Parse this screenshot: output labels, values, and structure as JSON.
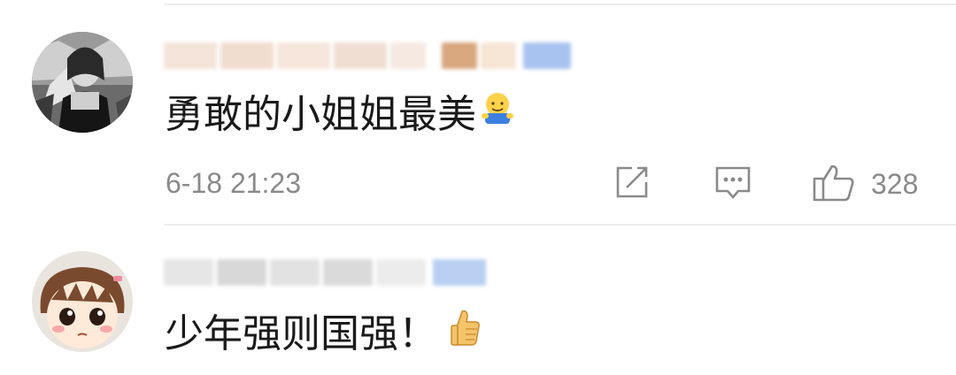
{
  "comments": [
    {
      "username": "",
      "text": "勇敢的小姐姐最美",
      "emoji": "hug-emoji",
      "timestamp": "6-18 21:23",
      "likes": "328",
      "actions": [
        "share-icon",
        "comment-icon",
        "thumbs-up-icon"
      ]
    },
    {
      "username": "",
      "text": "少年强则国强！",
      "emoji": "thumbs-up-emoji"
    }
  ],
  "colors": {
    "text": "#1a1a1a",
    "meta": "#8a8a8a",
    "icon": "#8a8a8a",
    "divider": "#eeeeee"
  }
}
